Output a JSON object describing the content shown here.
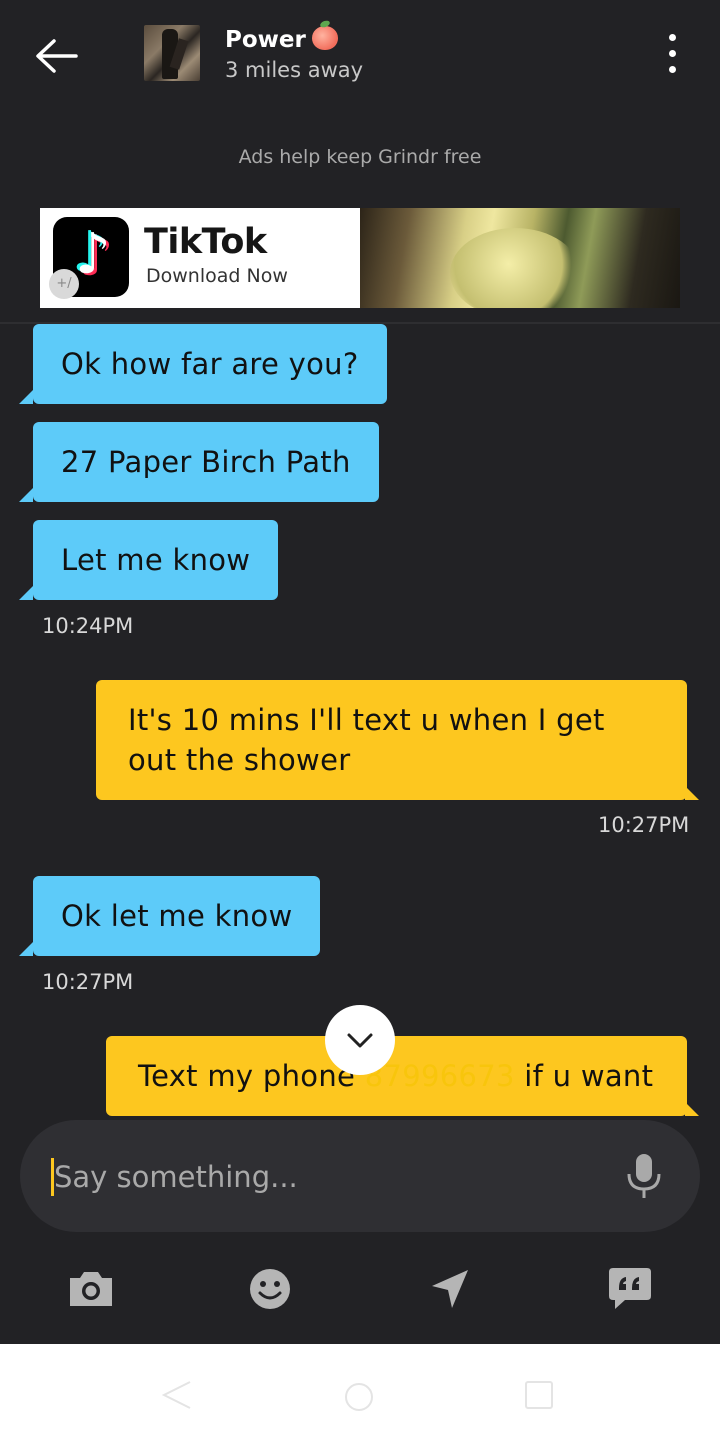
{
  "header": {
    "name": "Power",
    "distance": "3 miles away"
  },
  "ads": {
    "label": "Ads help keep Grindr free",
    "title": "TikTok",
    "subtitle": "Download Now",
    "badge": "+/"
  },
  "messages": [
    {
      "direction": "incoming",
      "text": "Ok how far are you?"
    },
    {
      "direction": "incoming",
      "text": "27 Paper Birch Path"
    },
    {
      "direction": "incoming",
      "text": "Let me know",
      "time": "10:24PM"
    },
    {
      "direction": "outgoing",
      "text": "It's 10 mins I'll text u when I get out the shower",
      "time": "10:27PM"
    },
    {
      "direction": "incoming",
      "text": "Ok let me know",
      "time": "10:27PM"
    },
    {
      "direction": "outgoing",
      "text_before": "Text my phone",
      "text_redacted": "87996673",
      "text_after": "if u want"
    }
  ],
  "input": {
    "placeholder": "Say something..."
  },
  "toolbar": {
    "icons": [
      "camera-icon",
      "emoji-icon",
      "location-icon",
      "saved-phrases-icon"
    ]
  },
  "colors": {
    "background": "#222225",
    "incoming_bubble": "#5dcbf9",
    "outgoing_bubble": "#fdc71f",
    "input_bar": "#2f2f33"
  }
}
